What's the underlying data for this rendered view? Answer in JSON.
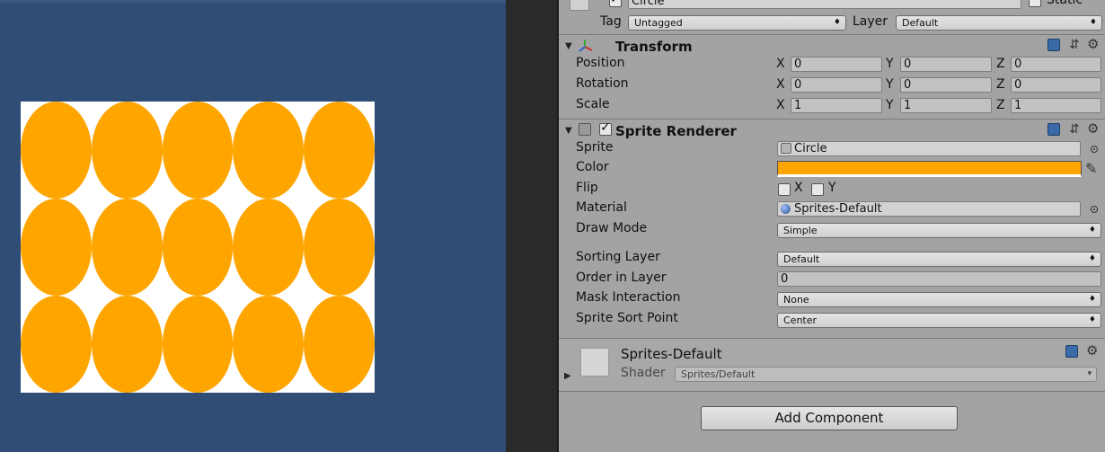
{
  "scene": {
    "background_color": "#2f4d75",
    "sprite_background": "#ffffff",
    "circle_color": "#ffa500",
    "grid": {
      "rows": 3,
      "cols": 5
    }
  },
  "inspector": {
    "gameobject": {
      "name": "Circle",
      "static_label": "Static",
      "tag_label": "Tag",
      "tag_value": "Untagged",
      "layer_label": "Layer",
      "layer_value": "Default"
    },
    "transform": {
      "title": "Transform",
      "rows": [
        {
          "label": "Position",
          "x": "0",
          "y": "0",
          "z": "0"
        },
        {
          "label": "Rotation",
          "x": "0",
          "y": "0",
          "z": "0"
        },
        {
          "label": "Scale",
          "x": "1",
          "y": "1",
          "z": "1"
        }
      ],
      "axis_x": "X",
      "axis_y": "Y",
      "axis_z": "Z"
    },
    "sprite_renderer": {
      "title": "Sprite Renderer",
      "sprite_label": "Sprite",
      "sprite_value": "Circle",
      "color_label": "Color",
      "color_value": "#ffa500",
      "flip_label": "Flip",
      "flip_x": "X",
      "flip_y": "Y",
      "material_label": "Material",
      "material_value": "Sprites-Default",
      "draw_mode_label": "Draw Mode",
      "draw_mode_value": "Simple",
      "sorting_layer_label": "Sorting Layer",
      "sorting_layer_value": "Default",
      "order_label": "Order in Layer",
      "order_value": "0",
      "mask_label": "Mask Interaction",
      "mask_value": "None",
      "sort_point_label": "Sprite Sort Point",
      "sort_point_value": "Center"
    },
    "material": {
      "name": "Sprites-Default",
      "shader_label": "Shader",
      "shader_value": "Sprites/Default"
    },
    "add_component_label": "Add Component"
  }
}
